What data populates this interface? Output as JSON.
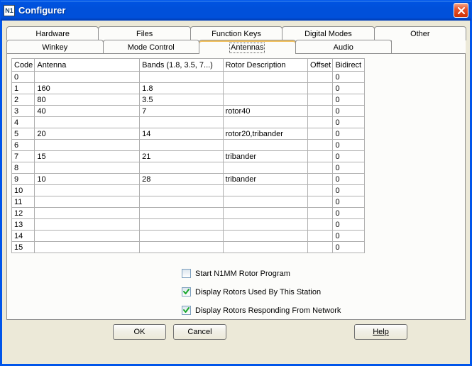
{
  "window": {
    "title": "Configurer"
  },
  "tabs": {
    "row1": [
      "Hardware",
      "Files",
      "Function Keys",
      "Digital Modes",
      "Other"
    ],
    "row2": [
      "Winkey",
      "Mode Control",
      "Antennas",
      "Audio"
    ],
    "active": "Antennas"
  },
  "table": {
    "headers": {
      "code": "Code",
      "antenna": "Antenna",
      "bands": "Bands (1.8, 3.5, 7...)",
      "rotor": "Rotor Description",
      "offset": "Offset",
      "bidirect": "Bidirect"
    },
    "rows": [
      {
        "code": "0",
        "antenna": "",
        "bands": "",
        "rotor": "",
        "offset": "",
        "bidirect": "0"
      },
      {
        "code": "1",
        "antenna": "160",
        "bands": "1.8",
        "rotor": "",
        "offset": "",
        "bidirect": "0"
      },
      {
        "code": "2",
        "antenna": "80",
        "bands": "3.5",
        "rotor": "",
        "offset": "",
        "bidirect": "0"
      },
      {
        "code": "3",
        "antenna": "40",
        "bands": "7",
        "rotor": "rotor40",
        "offset": "",
        "bidirect": "0"
      },
      {
        "code": "4",
        "antenna": "",
        "bands": "",
        "rotor": "",
        "offset": "",
        "bidirect": "0"
      },
      {
        "code": "5",
        "antenna": "20",
        "bands": "14",
        "rotor": "rotor20,tribander",
        "offset": "",
        "bidirect": "0"
      },
      {
        "code": "6",
        "antenna": "",
        "bands": "",
        "rotor": "",
        "offset": "",
        "bidirect": "0"
      },
      {
        "code": "7",
        "antenna": "15",
        "bands": "21",
        "rotor": "tribander",
        "offset": "",
        "bidirect": "0"
      },
      {
        "code": "8",
        "antenna": "",
        "bands": "",
        "rotor": "",
        "offset": "",
        "bidirect": "0"
      },
      {
        "code": "9",
        "antenna": "10",
        "bands": "28",
        "rotor": "tribander",
        "offset": "",
        "bidirect": "0"
      },
      {
        "code": "10",
        "antenna": "",
        "bands": "",
        "rotor": "",
        "offset": "",
        "bidirect": "0"
      },
      {
        "code": "11",
        "antenna": "",
        "bands": "",
        "rotor": "",
        "offset": "",
        "bidirect": "0"
      },
      {
        "code": "12",
        "antenna": "",
        "bands": "",
        "rotor": "",
        "offset": "",
        "bidirect": "0"
      },
      {
        "code": "13",
        "antenna": "",
        "bands": "",
        "rotor": "",
        "offset": "",
        "bidirect": "0"
      },
      {
        "code": "14",
        "antenna": "",
        "bands": "",
        "rotor": "",
        "offset": "",
        "bidirect": "0"
      },
      {
        "code": "15",
        "antenna": "",
        "bands": "",
        "rotor": "",
        "offset": "",
        "bidirect": "0"
      }
    ]
  },
  "checks": {
    "start_rotor": {
      "label": "Start N1MM Rotor Program",
      "checked": false
    },
    "display_used": {
      "label": "Display Rotors Used By This Station",
      "checked": true
    },
    "display_network": {
      "label": "Display Rotors Responding From Network",
      "checked": true
    }
  },
  "buttons": {
    "ok": "OK",
    "cancel": "Cancel",
    "help": "Help"
  }
}
